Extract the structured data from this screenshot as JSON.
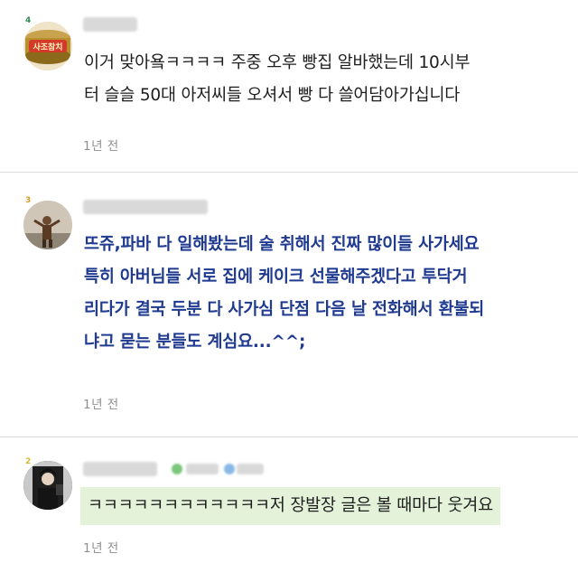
{
  "comments": [
    {
      "level": "4",
      "avatar_text": "사조참치",
      "text_lines": [
        "이거 맞아욬ㅋㅋㅋㅋ 주중 오후 빵집 알바했는데 10시부",
        "터 슬슬 50대 아저씨들 오셔서 빵 다 쓸어담아가십니다"
      ],
      "time": "1년 전"
    },
    {
      "level": "3",
      "text_lines": [
        "뜨쥬,파바 다 일해봤는데 술 취해서 진짜 많이들 사가세요",
        "특히 아버님들 서로 집에 케이크 선물해주겠다고 투닥거",
        "리다가 결국 두분 다 사가심 단점 다음 날 전화해서 환불되",
        "냐고 묻는 분들도 계심요...^^;"
      ],
      "time": "1년 전"
    },
    {
      "level": "2",
      "text_lines": [
        "ㅋㅋㅋㅋㅋㅋㅋㅋㅋㅋㅋㅋ저 장발장 글은 볼 때마다 웃겨요"
      ],
      "time": "1년 전"
    }
  ],
  "colors": {
    "blue_text": "#1f3a8f",
    "highlight_bg": "#e4f2d9",
    "time_text": "#8e8e8e",
    "level_4": "#2e8b57",
    "level_3": "#d49a28",
    "level_2": "#d8b828"
  }
}
